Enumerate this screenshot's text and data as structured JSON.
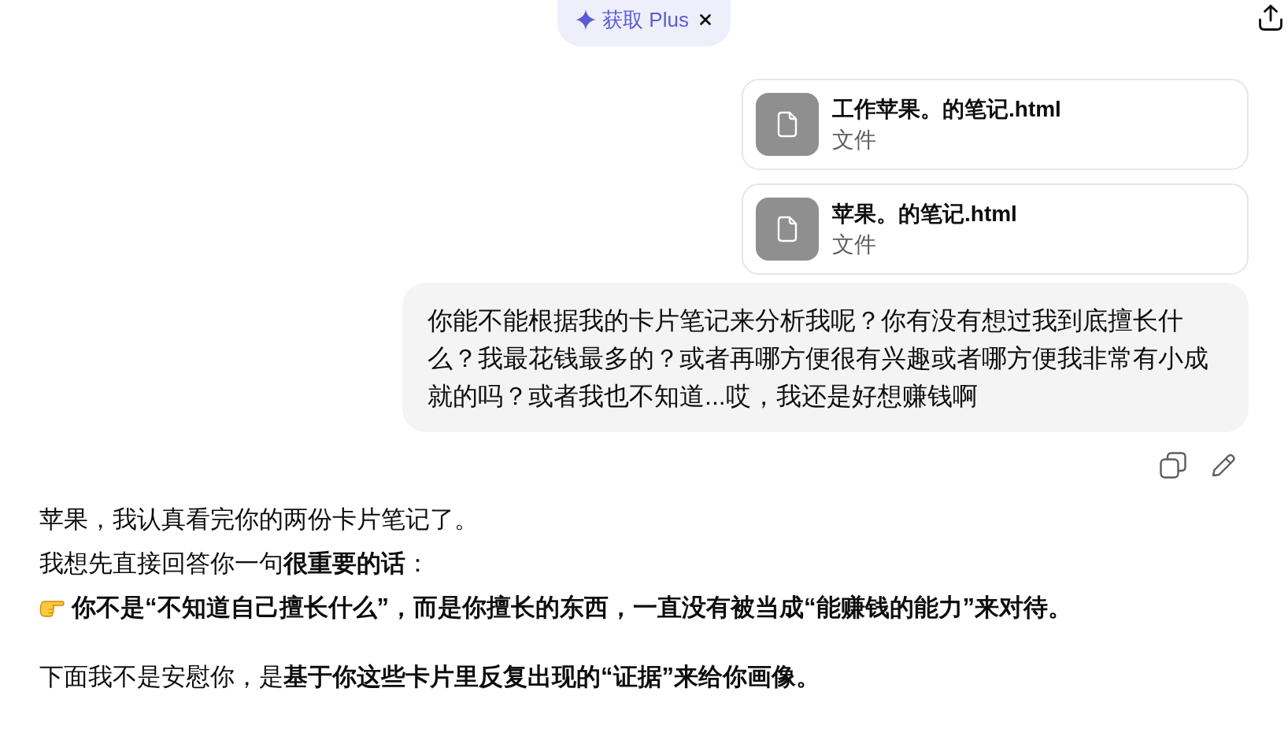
{
  "upgrade_banner": {
    "label": "获取 Plus"
  },
  "attachments": [
    {
      "name": "工作苹果。的笔记.html",
      "type_label": "文件"
    },
    {
      "name": "苹果。的笔记.html",
      "type_label": "文件"
    }
  ],
  "user_message": {
    "text": "你能不能根据我的卡片笔记来分析我呢？你有没有想过我到底擅长什么？我最花钱最多的？或者再哪方便很有兴趣或者哪方便我非常有小成就的吗？或者我也不知道...哎，我还是好想赚钱啊"
  },
  "assistant_message": {
    "paragraphs": [
      {
        "kind": "text",
        "text": "苹果，我认真看完你的两份卡片笔记了。"
      },
      {
        "kind": "text",
        "text": "我想先直接回答你一句**很重要的话**："
      },
      {
        "kind": "callout",
        "text": "你不是“不知道自己擅长什么”，而是你擅长的东西，一直没有被当成“能赚钱的能力”来对待。"
      },
      {
        "kind": "text",
        "text": "下面我不是安慰你，是**基于你这些卡片里反复出现的“证据”来给你画像。**"
      }
    ]
  }
}
